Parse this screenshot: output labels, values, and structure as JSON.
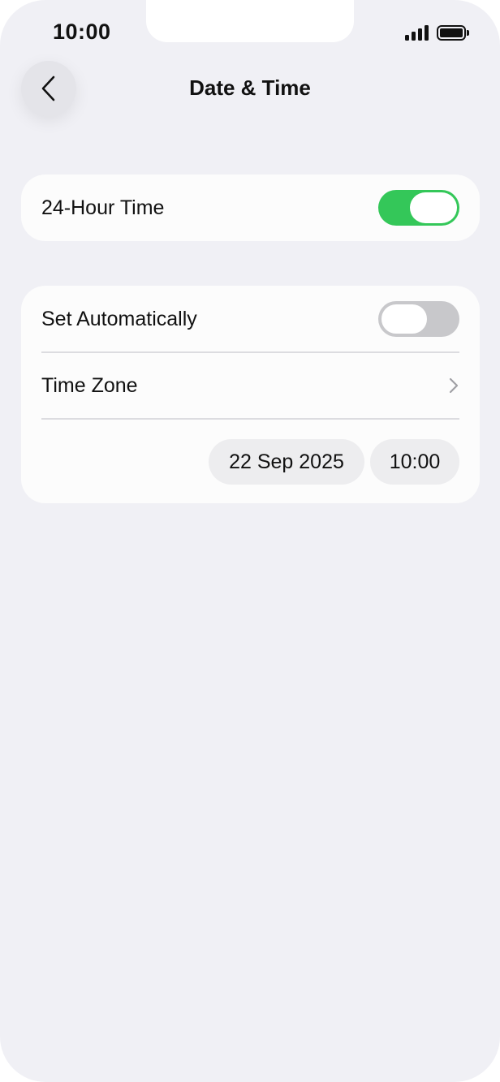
{
  "status_bar": {
    "time": "10:00",
    "signal_icon": "cellular-signal-icon",
    "battery_icon": "battery-icon"
  },
  "nav": {
    "back_icon": "chevron-left-icon",
    "title": "Date & Time"
  },
  "settings": {
    "hour24": {
      "label": "24-Hour Time",
      "enabled": true
    },
    "set_automatically": {
      "label": "Set Automatically",
      "enabled": false
    },
    "time_zone": {
      "label": "Time Zone",
      "icon": "chevron-right-icon"
    },
    "date_value": "22 Sep 2025",
    "time_value": "10:00"
  },
  "colors": {
    "toggle_on": "#34c759",
    "toggle_off": "#c8c8cb",
    "background": "#f0f0f5"
  }
}
